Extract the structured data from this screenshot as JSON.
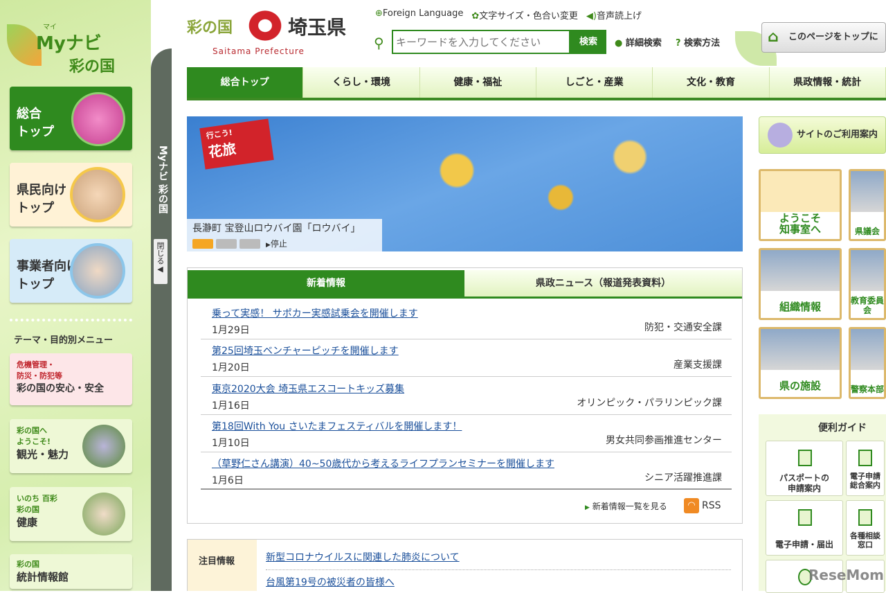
{
  "sidebar": {
    "logo_ruby": "マイ",
    "logo_line1": "Myナビ",
    "logo_line2": "彩の国",
    "buttons": [
      {
        "label": "総合\nトップ"
      },
      {
        "label": "県民向け\nトップ"
      },
      {
        "label": "事業者向け\nトップ"
      }
    ],
    "theme_heading": "テーマ・目的別メニュー",
    "themes": [
      {
        "sub": "危機管理・\n防災・防犯等",
        "title": "彩の国の安心・安全"
      },
      {
        "sub": "彩の国へ\nようこそ!",
        "title": "観光・魅力"
      },
      {
        "sub": "いのち 百彩\n彩の国",
        "title": "健康"
      },
      {
        "sub": "彩の国",
        "title": "統計情報館"
      }
    ],
    "strip_title": "Myナビ 彩の国",
    "close_label": "閉じる◀"
  },
  "header": {
    "logo_left": "彩の国",
    "logo_right": "埼玉県",
    "logo_en": "Saitama Prefecture",
    "links": [
      "Foreign Language",
      "文字サイズ・色合い変更",
      "音声読上げ"
    ],
    "search_placeholder": "キーワードを入力してください",
    "search_button": "検索",
    "advanced_search": "詳細検索",
    "search_help": "検索方法",
    "set_top_button": "このページをトップに"
  },
  "nav": [
    "総合トップ",
    "くらし・環境",
    "健康・福祉",
    "しごと・産業",
    "文化・教育",
    "県政情報・統計"
  ],
  "banner": {
    "badge_line1": "行こう!",
    "badge_line2": "花旅",
    "caption": "長瀞町 宝登山ロウバイ園「ロウバイ」",
    "stop": "停止"
  },
  "news": {
    "tabs": [
      "新着情報",
      "県政ニュース（報道発表資料）"
    ],
    "items": [
      {
        "title": "乗って実感！ サポカー実感試乗会を開催します",
        "date": "1月29日",
        "section": "防犯・交通安全課"
      },
      {
        "title": "第25回埼玉ベンチャーピッチを開催します",
        "date": "1月20日",
        "section": "産業支援課"
      },
      {
        "title": "東京2020大会 埼玉県エスコートキッズ募集",
        "date": "1月16日",
        "section": "オリンピック・パラリンピック課"
      },
      {
        "title": "第18回With You さいたまフェスティバルを開催します！",
        "date": "1月10日",
        "section": "男女共同参画推進センター"
      },
      {
        "title": "（草野仁さん講演）40~50歳代から考えるライフプランセミナーを開催します",
        "date": "1月6日",
        "section": "シニア活躍推進課"
      }
    ],
    "more": "新着情報一覧を見る",
    "rss": "RSS"
  },
  "attention": {
    "label": "注目情報",
    "items": [
      "新型コロナウイルスに関連した肺炎について",
      "台風第19号の被災者の皆様へ"
    ]
  },
  "right": {
    "usage": "サイトのご利用案内",
    "pics": [
      "ようこそ\n知事室へ",
      "県議会",
      "組織情報",
      "教育委員会",
      "県の施設",
      "警察本部"
    ],
    "guide_title": "便利ガイド",
    "guides": [
      "パスポートの\n申請案内",
      "電子申請\n総合案内",
      "電子申請・届出",
      "各種相談窓口",
      "",
      ""
    ]
  },
  "watermark": "ReseMom"
}
